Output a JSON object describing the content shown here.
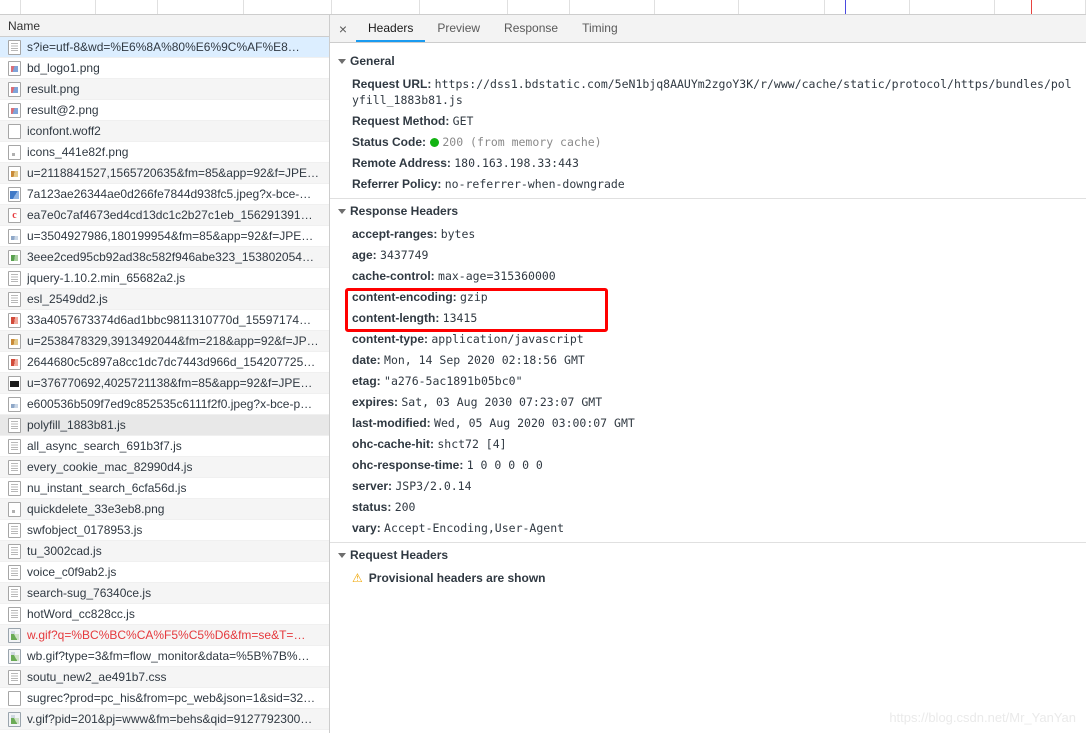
{
  "overview": {
    "segment_count": 14,
    "dom_content_loaded_color": "#4a4ae0",
    "load_event_color": "#e8433f"
  },
  "requests_panel": {
    "column_header": "Name",
    "rows": [
      {
        "name": "s?ie=utf-8&wd=%E6%8A%80%E6%9C%AF%E8…",
        "icon": "document-icon",
        "state": "selected",
        "error": false
      },
      {
        "name": "bd_logo1.png",
        "icon": "image-icon",
        "state": "even",
        "error": false
      },
      {
        "name": "result.png",
        "icon": "image-icon",
        "state": "odd",
        "error": false
      },
      {
        "name": "result@2.png",
        "icon": "image-icon",
        "state": "even",
        "error": false
      },
      {
        "name": "iconfont.woff2",
        "icon": "plain-file-icon",
        "state": "odd",
        "error": false
      },
      {
        "name": "icons_441e82f.png",
        "icon": "tiny-image-icon",
        "state": "even",
        "error": false
      },
      {
        "name": "u=2118841527,1565720635&fm=85&app=92&f=JPE…",
        "icon": "image-orange-icon",
        "state": "odd",
        "error": false
      },
      {
        "name": "7a123ae26344ae0d266fe7844d938fc5.jpeg?x-bce-…",
        "icon": "image-blue-icon",
        "state": "even",
        "error": false
      },
      {
        "name": "ea7e0c7af4673ed4cd13dc1c2b27c1eb_156291391…",
        "icon": "css-icon",
        "state": "odd",
        "error": false
      },
      {
        "name": "u=3504927986,180199954&fm=85&app=92&f=JPE…",
        "icon": "image-soft-icon",
        "state": "even",
        "error": false
      },
      {
        "name": "3eee2ced95cb92ad38c582f946abe323_153802054…",
        "icon": "image-green-icon",
        "state": "odd",
        "error": false
      },
      {
        "name": "jquery-1.10.2.min_65682a2.js",
        "icon": "document-icon",
        "state": "even",
        "error": false
      },
      {
        "name": "esl_2549dd2.js",
        "icon": "document-icon",
        "state": "odd",
        "error": false
      },
      {
        "name": "33a4057673374d6ad1bbc9811310770d_15597174…",
        "icon": "image-red-icon",
        "state": "even",
        "error": false
      },
      {
        "name": "u=2538478329,3913492044&fm=218&app=92&f=JP…",
        "icon": "image-orange-icon",
        "state": "odd",
        "error": false
      },
      {
        "name": "2644680c5c897a8cc1dc7dc7443d966d_154207725…",
        "icon": "image-red-icon",
        "state": "even",
        "error": false
      },
      {
        "name": "u=376770692,4025721138&fm=85&app=92&f=JPE…",
        "icon": "image-black-icon",
        "state": "odd",
        "error": false
      },
      {
        "name": "e600536b509f7ed9c852535c6111f2f0.jpeg?x-bce-p…",
        "icon": "image-soft-icon",
        "state": "even",
        "error": false
      },
      {
        "name": "polyfill_1883b81.js",
        "icon": "document-icon",
        "state": "active",
        "error": false
      },
      {
        "name": "all_async_search_691b3f7.js",
        "icon": "document-icon",
        "state": "even",
        "error": false
      },
      {
        "name": "every_cookie_mac_82990d4.js",
        "icon": "document-icon",
        "state": "odd",
        "error": false
      },
      {
        "name": "nu_instant_search_6cfa56d.js",
        "icon": "document-icon",
        "state": "even",
        "error": false
      },
      {
        "name": "quickdelete_33e3eb8.png",
        "icon": "tiny-image-icon",
        "state": "odd",
        "error": false
      },
      {
        "name": "swfobject_0178953.js",
        "icon": "document-icon",
        "state": "even",
        "error": false
      },
      {
        "name": "tu_3002cad.js",
        "icon": "document-icon",
        "state": "odd",
        "error": false
      },
      {
        "name": "voice_c0f9ab2.js",
        "icon": "document-icon",
        "state": "even",
        "error": false
      },
      {
        "name": "search-sug_76340ce.js",
        "icon": "document-icon",
        "state": "odd",
        "error": false
      },
      {
        "name": "hotWord_cc828cc.js",
        "icon": "document-icon",
        "state": "even",
        "error": false
      },
      {
        "name": "w.gif?q=%BC%BC%CA%F5%C5%D6&fm=se&T=…",
        "icon": "gif-image-icon",
        "state": "odd",
        "error": true
      },
      {
        "name": "wb.gif?type=3&fm=flow_monitor&data=%5B%7B%…",
        "icon": "gif-image-icon",
        "state": "even",
        "error": false
      },
      {
        "name": "soutu_new2_ae491b7.css",
        "icon": "document-icon",
        "state": "odd",
        "error": false
      },
      {
        "name": "sugrec?prod=pc_his&from=pc_web&json=1&sid=32…",
        "icon": "plain-file-icon",
        "state": "even",
        "error": false
      },
      {
        "name": "v.gif?pid=201&pj=www&fm=behs&qid=9127792300…",
        "icon": "gif-image-icon",
        "state": "odd",
        "error": false
      }
    ]
  },
  "details_panel": {
    "close_label": "×",
    "tabs": [
      {
        "label": "Headers",
        "active": true
      },
      {
        "label": "Preview",
        "active": false
      },
      {
        "label": "Response",
        "active": false
      },
      {
        "label": "Timing",
        "active": false
      }
    ],
    "general": {
      "title": "General",
      "rows": [
        {
          "key": "Request URL:",
          "value": "https://dss1.bdstatic.com/5eN1bjq8AAUYm2zgoY3K/r/www/cache/static/protocol/https/bundles/polyfill_1883b81.js"
        },
        {
          "key": "Request Method:",
          "value": "GET"
        },
        {
          "key": "Status Code:",
          "value": "200",
          "extra": "(from memory cache)",
          "status_dot": true
        },
        {
          "key": "Remote Address:",
          "value": "180.163.198.33:443"
        },
        {
          "key": "Referrer Policy:",
          "value": "no-referrer-when-downgrade"
        }
      ]
    },
    "response_headers": {
      "title": "Response Headers",
      "rows": [
        {
          "key": "accept-ranges:",
          "value": "bytes"
        },
        {
          "key": "age:",
          "value": "3437749"
        },
        {
          "key": "cache-control:",
          "value": "max-age=315360000"
        },
        {
          "key": "content-encoding:",
          "value": "gzip"
        },
        {
          "key": "content-length:",
          "value": "13415"
        },
        {
          "key": "content-type:",
          "value": "application/javascript"
        },
        {
          "key": "date:",
          "value": "Mon, 14 Sep 2020 02:18:56 GMT"
        },
        {
          "key": "etag:",
          "value": "\"a276-5ac1891b05bc0\""
        },
        {
          "key": "expires:",
          "value": "Sat, 03 Aug 2030 07:23:07 GMT"
        },
        {
          "key": "last-modified:",
          "value": "Wed, 05 Aug 2020 03:00:07 GMT"
        },
        {
          "key": "ohc-cache-hit:",
          "value": "shct72 [4]"
        },
        {
          "key": "ohc-response-time:",
          "value": "1 0 0 0 0 0"
        },
        {
          "key": "server:",
          "value": "JSP3/2.0.14"
        },
        {
          "key": "status:",
          "value": "200"
        },
        {
          "key": "vary:",
          "value": "Accept-Encoding,User-Agent"
        }
      ]
    },
    "request_headers": {
      "title": "Request Headers",
      "warning": "Provisional headers are shown"
    }
  },
  "annotation": {
    "highlight_color": "#ff0000",
    "highlighted_keys": [
      "content-encoding",
      "content-length"
    ]
  },
  "watermark": "https://blog.csdn.net/Mr_YanYan"
}
